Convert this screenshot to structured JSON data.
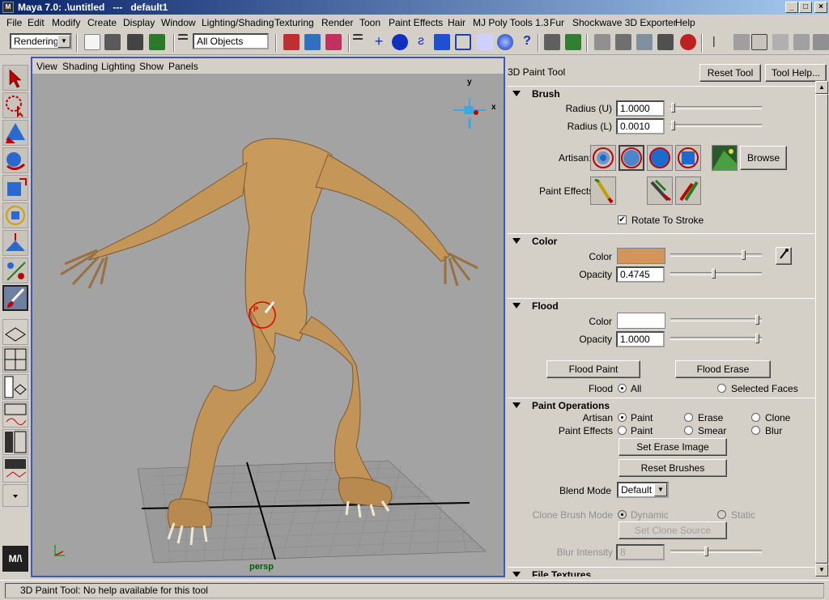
{
  "window": {
    "title": "Maya 7.0: .\\untitled   ---   default1",
    "min": "_",
    "max": "□",
    "close": "×"
  },
  "menu": [
    "File",
    "Edit",
    "Modify",
    "Create",
    "Display",
    "Window",
    "Lighting/Shading",
    "Texturing",
    "Render",
    "Toon",
    "Paint Effects",
    "Hair",
    "MJ Poly Tools 1.3",
    "Fur",
    "Shockwave 3D Exporter",
    "Help"
  ],
  "toolbar": {
    "menuset": "Rendering",
    "selection": "All Objects"
  },
  "viewport": {
    "menu": [
      "View",
      "Shading",
      "Lighting",
      "Show",
      "Panels"
    ],
    "camera_label": "persp",
    "axis_y": "y",
    "axis_x": "x",
    "brush_marker": "P"
  },
  "panel": {
    "title": "3D Paint Tool",
    "reset_tool": "Reset Tool",
    "tool_help": "Tool Help...",
    "brush": {
      "header": "Brush",
      "radius_u_label": "Radius (U)",
      "radius_u": "1.0000",
      "radius_l_label": "Radius (L)",
      "radius_l": "0.0010",
      "artisan_label": "Artisan:",
      "browse": "Browse",
      "paint_effects_label": "Paint Effects:",
      "rotate_to_stroke": "Rotate To Stroke"
    },
    "color": {
      "header": "Color",
      "color_label": "Color",
      "color_value": "#d4955a",
      "opacity_label": "Opacity",
      "opacity": "0.4745"
    },
    "flood": {
      "header": "Flood",
      "color_label": "Color",
      "color_value": "#ffffff",
      "opacity_label": "Opacity",
      "opacity": "1.0000",
      "flood_paint": "Flood Paint",
      "flood_erase": "Flood Erase",
      "flood_label": "Flood",
      "all": "All",
      "selected_faces": "Selected Faces"
    },
    "paint_ops": {
      "header": "Paint Operations",
      "artisan_label": "Artisan",
      "paint": "Paint",
      "erase": "Erase",
      "clone": "Clone",
      "pe_label": "Paint Effects",
      "pe_paint": "Paint",
      "smear": "Smear",
      "blur": "Blur",
      "set_erase_image": "Set Erase Image",
      "reset_brushes": "Reset Brushes",
      "blend_mode_label": "Blend Mode",
      "blend_mode": "Default",
      "clone_brush_mode_label": "Clone Brush Mode",
      "dynamic": "Dynamic",
      "static": "Static",
      "set_clone_source": "Set Clone Source",
      "blur_intensity_label": "Blur Intensity",
      "blur_intensity": "8"
    },
    "file_textures": {
      "header": "File Textures"
    }
  },
  "status": "3D Paint Tool: No help available for this tool"
}
